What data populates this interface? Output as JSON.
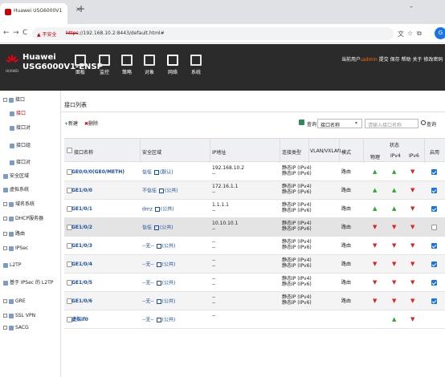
{
  "browser": {
    "tab_title": "Huawei USG6000V1",
    "tab_close": "×",
    "new_tab": "+",
    "not_secure": "不安全",
    "url_protocol": "https",
    "url_rest": "://192.168.10.2:8443/default.html#",
    "minimize": "–",
    "avatar_letter": "G"
  },
  "header": {
    "brand_line1": "Huawei",
    "brand_line2": "USG6000V1-ENSP",
    "logo_text": "HUAWEI",
    "nav": [
      "面板",
      "监控",
      "策略",
      "对象",
      "网络",
      "系统"
    ],
    "user_prefix": "当前用户:",
    "user_name": "admin",
    "user_links": "提交 保存 帮助 关于 修改密码"
  },
  "sidebar": {
    "items": [
      {
        "label": "接口",
        "sel": false
      },
      {
        "label": "接口",
        "sel": true
      },
      {
        "label": "接口对",
        "sel": false
      },
      {
        "label": "接口组",
        "sel": false
      },
      {
        "label": "接口对",
        "sel": false
      },
      {
        "label": "安全区域",
        "sel": false
      },
      {
        "label": "虚拟系统",
        "sel": false
      },
      {
        "label": "域名系统",
        "sel": false
      },
      {
        "label": "DHCP服务器",
        "sel": false
      },
      {
        "label": "路由",
        "sel": false
      },
      {
        "label": "IPSec",
        "sel": false
      },
      {
        "label": "L2TP",
        "sel": false
      },
      {
        "label": "基于 IPSec 的 L2TP",
        "sel": false
      },
      {
        "label": "GRE",
        "sel": false
      },
      {
        "label": "SSL VPN",
        "sel": false
      },
      {
        "label": "SACG",
        "sel": false
      }
    ]
  },
  "content": {
    "title": "接口列表",
    "new_label": "新建",
    "delete_label": "删除",
    "search_label": "查询",
    "search_field_value": "接口名称",
    "search_keyword_placeholder": "请输入接口名称",
    "query_label": "查询",
    "columns": {
      "name": "接口名称",
      "zone": "安全区域",
      "ip": "IP地址",
      "conn": "连接类型",
      "vlan": "VLAN/VXLAN",
      "mode": "模式",
      "status": "状态",
      "phys": "物理",
      "ipv4": "IPv4",
      "ipv6": "IPv6",
      "enable": "启用"
    }
  },
  "rows": [
    {
      "name": "GE0/0/0(GE0/METH)",
      "zone": "信任",
      "zone_tag": "默认",
      "ip1": "192.168.10.2",
      "ip2": "--",
      "conn1": "静态IP (IPv4)",
      "conn2": "静态IP (IPv6)",
      "mode": "路由",
      "phys": "up",
      "ipv4": "up",
      "ipv6": "down",
      "enabled": true
    },
    {
      "name": "GE1/0/0",
      "zone": "不信任",
      "zone_tag": "公共",
      "ip1": "172.16.1.1",
      "ip2": "--",
      "conn1": "静态IP (IPv4)",
      "conn2": "静态IP (IPv6)",
      "mode": "路由",
      "phys": "up",
      "ipv4": "up",
      "ipv6": "down",
      "enabled": true
    },
    {
      "name": "GE1/0/1",
      "zone": "dmz",
      "zone_tag": "公共",
      "ip1": "1.1.1.1",
      "ip2": "--",
      "conn1": "静态IP (IPv4)",
      "conn2": "静态IP (IPv6)",
      "mode": "路由",
      "phys": "up",
      "ipv4": "up",
      "ipv6": "down",
      "enabled": true
    },
    {
      "name": "GE1/0/2",
      "zone": "信任",
      "zone_tag": "公共",
      "ip1": "10.10.10.1",
      "ip2": "--",
      "conn1": "静态IP (IPv4)",
      "conn2": "静态IP (IPv6)",
      "mode": "路由",
      "phys": "down",
      "ipv4": "down",
      "ipv6": "down",
      "enabled": false
    },
    {
      "name": "GE1/0/3",
      "zone": "--无--",
      "zone_tag": "公共",
      "ip1": "--",
      "ip2": "--",
      "conn1": "静态IP (IPv4)",
      "conn2": "静态IP (IPv6)",
      "mode": "路由",
      "phys": "down",
      "ipv4": "down",
      "ipv6": "down",
      "enabled": true
    },
    {
      "name": "GE1/0/4",
      "zone": "--无--",
      "zone_tag": "公共",
      "ip1": "--",
      "ip2": "--",
      "conn1": "静态IP (IPv4)",
      "conn2": "静态IP (IPv6)",
      "mode": "路由",
      "phys": "down",
      "ipv4": "down",
      "ipv6": "down",
      "enabled": true
    },
    {
      "name": "GE1/0/5",
      "zone": "--无--",
      "zone_tag": "公共",
      "ip1": "--",
      "ip2": "--",
      "conn1": "静态IP (IPv4)",
      "conn2": "静态IP (IPv6)",
      "mode": "路由",
      "phys": "down",
      "ipv4": "down",
      "ipv6": "down",
      "enabled": true
    },
    {
      "name": "GE1/0/6",
      "zone": "--无--",
      "zone_tag": "公共",
      "ip1": "--",
      "ip2": "--",
      "conn1": "静态IP (IPv4)",
      "conn2": "静态IP (IPv6)",
      "mode": "路由",
      "phys": "down",
      "ipv4": "down",
      "ipv6": "down",
      "enabled": true
    },
    {
      "name": "虚拟if0",
      "zone": "--无--",
      "zone_tag": "公共",
      "ip1": "--",
      "ip2": "",
      "conn1": "",
      "conn2": "",
      "mode": "",
      "phys": "",
      "ipv4": "up",
      "ipv6": "down",
      "enabled": false
    }
  ]
}
